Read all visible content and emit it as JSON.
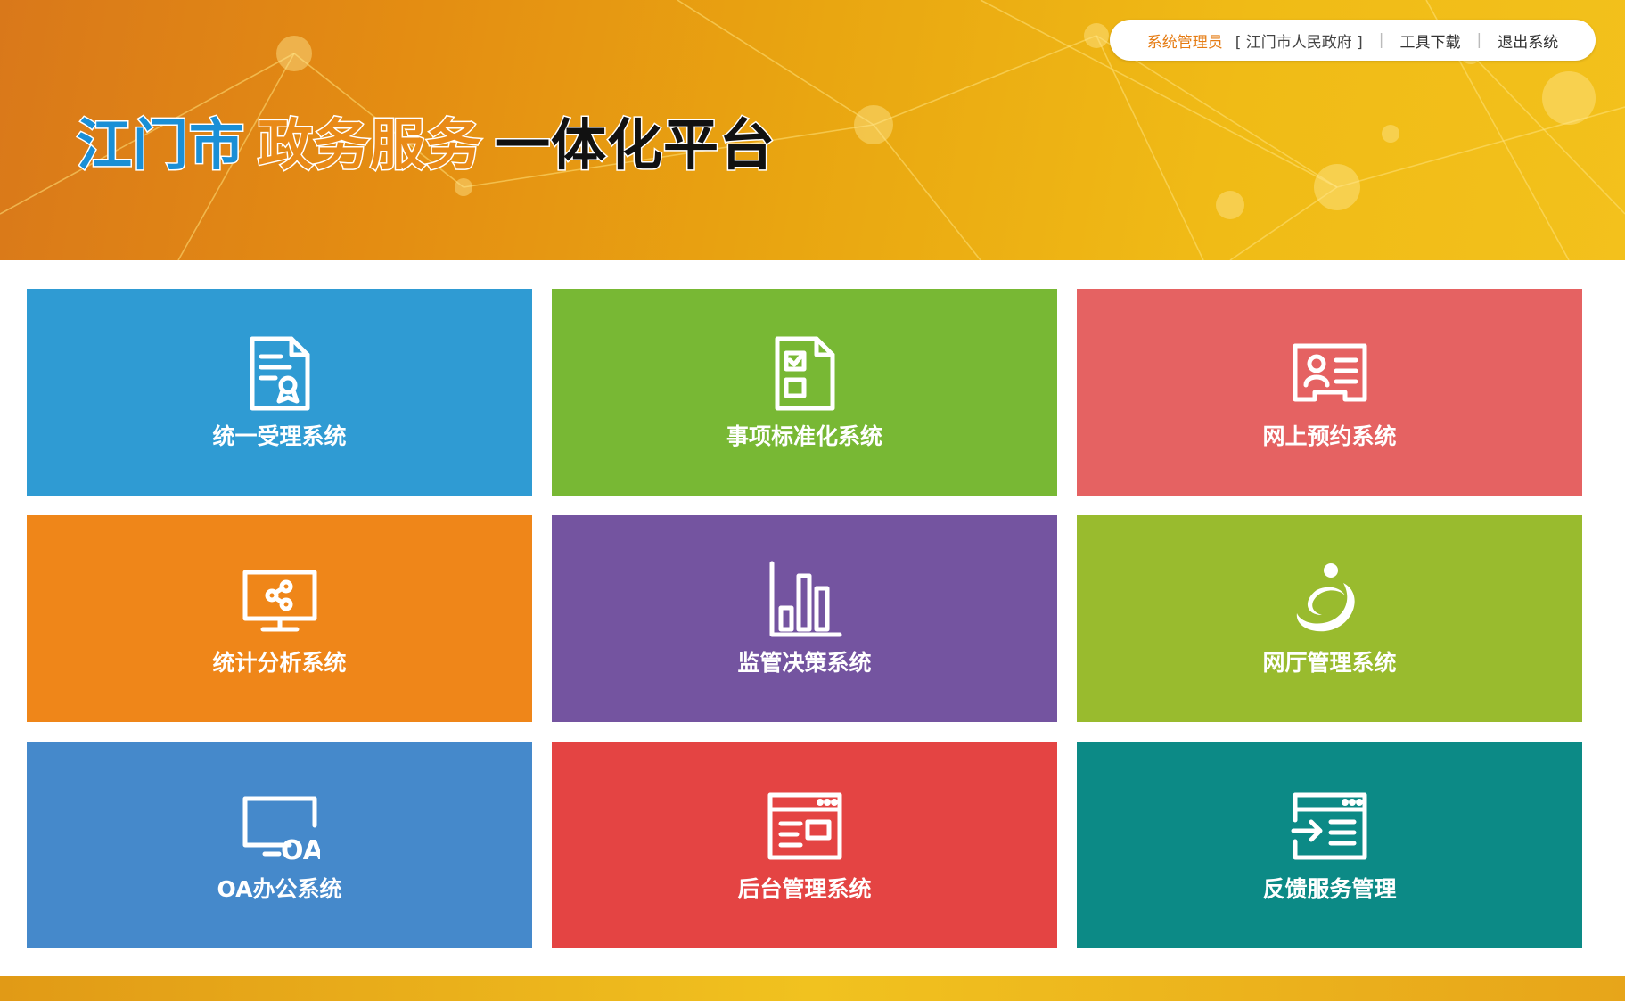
{
  "header": {
    "title_city": "江门市",
    "title_service": "政务服务",
    "title_platform": "一体化平台",
    "user_role": "系统管理员",
    "user_org": "[ 江门市人民政府 ]",
    "tools_download": "工具下载",
    "logout": "退出系统"
  },
  "tiles": [
    {
      "label": "统一受理系统",
      "color": "#2f9bd3",
      "icon": "certificate-document-icon"
    },
    {
      "label": "事项标准化系统",
      "color": "#78b834",
      "icon": "checklist-document-icon"
    },
    {
      "label": "网上预约系统",
      "color": "#e56262",
      "icon": "id-card-icon"
    },
    {
      "label": "统计分析系统",
      "color": "#ef8619",
      "icon": "monitor-share-icon"
    },
    {
      "label": "监管决策系统",
      "color": "#7454a0",
      "icon": "bar-chart-icon"
    },
    {
      "label": "网厅管理系统",
      "color": "#99bb2e",
      "icon": "web-hall-logo-icon"
    },
    {
      "label": "OA办公系统",
      "color": "#4589cb",
      "icon": "oa-monitor-icon"
    },
    {
      "label": "后台管理系统",
      "color": "#e44443",
      "icon": "browser-window-icon"
    },
    {
      "label": "反馈服务管理",
      "color": "#0c8a86",
      "icon": "feedback-window-icon"
    }
  ]
}
